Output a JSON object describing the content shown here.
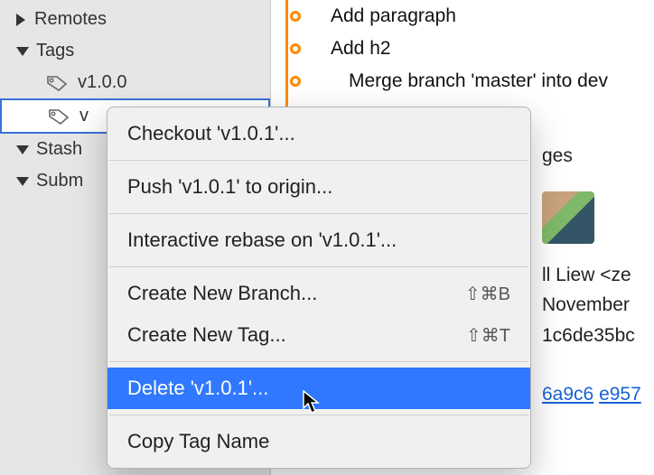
{
  "sidebar": {
    "remotes": "Remotes",
    "tags": "Tags",
    "tag_items": [
      "v1.0.0",
      "v"
    ],
    "stashes": "Stash",
    "submodules": "Subm"
  },
  "commits": [
    "Add paragraph",
    "Add h2",
    "Merge branch 'master' into dev"
  ],
  "menu": {
    "checkout": "Checkout 'v1.0.1'...",
    "push": "Push 'v1.0.1' to origin...",
    "rebase": "Interactive rebase on 'v1.0.1'...",
    "new_branch": "Create New Branch...",
    "new_branch_sc": "⇧⌘B",
    "new_tag": "Create New Tag...",
    "new_tag_sc": "⇧⌘T",
    "delete": "Delete 'v1.0.1'...",
    "copy": "Copy Tag Name"
  },
  "info": {
    "ges": "ges",
    "author": "ll Liew <ze",
    "date": "November",
    "hash": "1c6de35bc",
    "link1": "6a9c6",
    "link2": "e957"
  }
}
